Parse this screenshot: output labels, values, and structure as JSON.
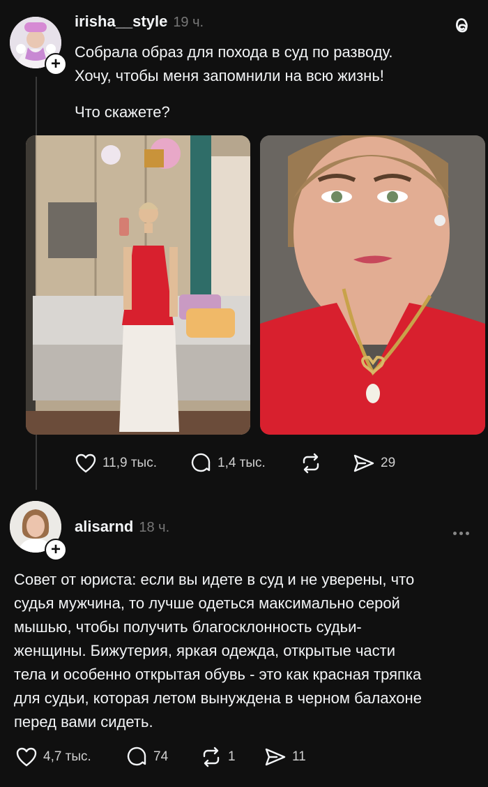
{
  "post1": {
    "username": "irisha__style",
    "time": "19 ч.",
    "text_line1": "Собрала образ для похода в суд по разводу.",
    "text_line2": "Хочу, чтобы меня запомнили на всю жизнь!",
    "text_line3": "Что скажете?",
    "likes": "11,9 тыс.",
    "comments": "1,4 тыс.",
    "shares": "29"
  },
  "post2": {
    "username": "alisarnd",
    "time": "18 ч.",
    "text_lines": [
      "Совет от юриста: если вы идете в суд и не уверены, что",
      "судья мужчина, то лучше одеться максимально серой",
      "мышью, чтобы получить благосклонность судьи-",
      "женщины. Бижутерия, яркая одежда, открытые части",
      "тела и особенно открытая обувь - это как красная тряпка",
      "для судьи, которая летом вынуждена в черном балахоне",
      "перед вами сидеть."
    ],
    "likes": "4,7 тыс.",
    "comments": "74",
    "reposts": "1",
    "shares": "11"
  },
  "icons": {
    "brand": "threads-icon",
    "like": "heart-icon",
    "comment": "speech-bubble-icon",
    "repost": "repost-icon",
    "share": "send-icon",
    "more": "more-dots-icon"
  },
  "colors": {
    "background": "#101010",
    "dress_red": "#d8202e"
  }
}
